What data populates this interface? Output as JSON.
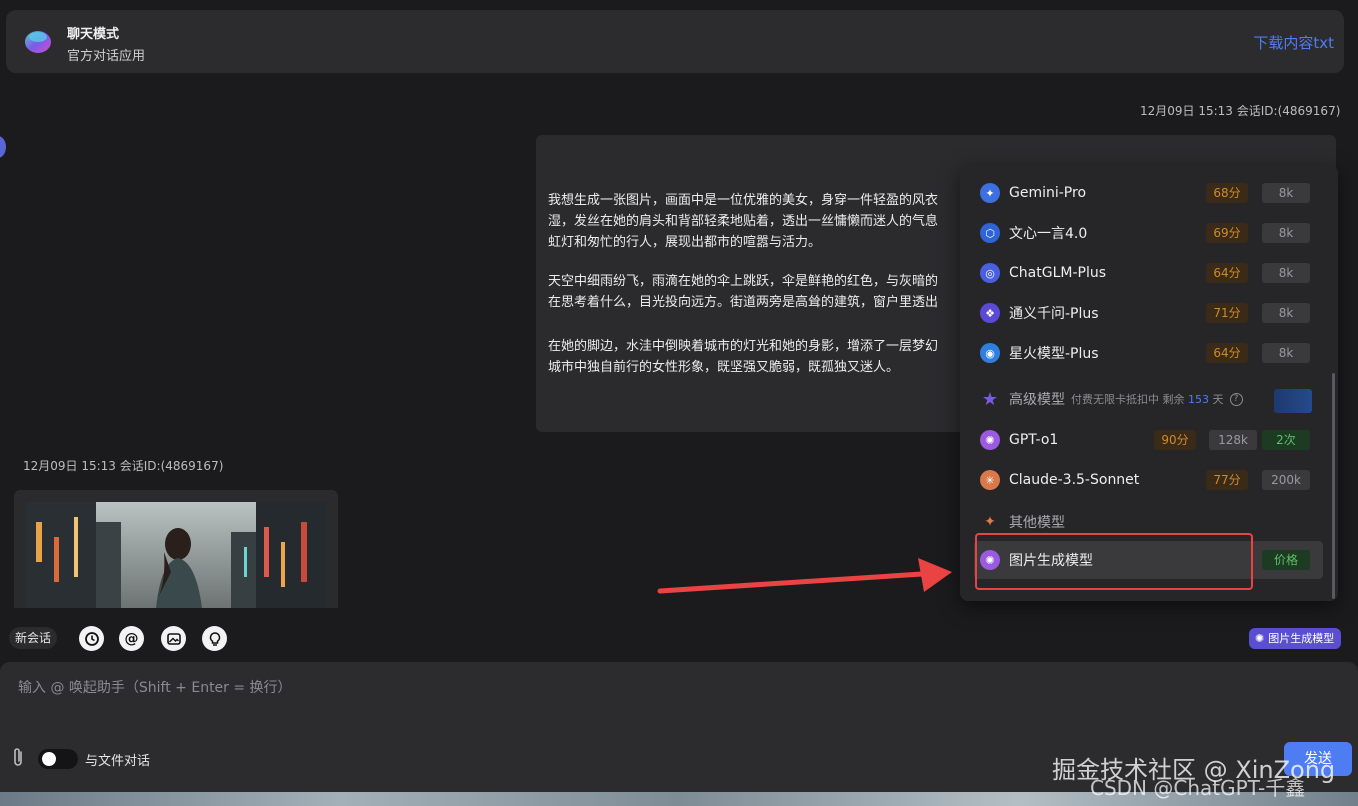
{
  "header": {
    "title": "聊天模式",
    "subtitle": "官方对话应用",
    "download": "下载内容txt"
  },
  "messages": {
    "user_meta": "12月09日 15:13 会话ID:(4869167)",
    "user_paragraphs": [
      "我想生成一张图片，画面中是一位优雅的美女，身穿一件轻盈的风衣\n湿，发丝在她的肩头和背部轻柔地贴着，透出一丝慵懒而迷人的气息\n虹灯和匆忙的行人，展现出都市的喧嚣与活力。",
      "天空中细雨纷飞，雨滴在她的伞上跳跃，伞是鲜艳的红色，与灰暗的\n在思考着什么，目光投向远方。街道两旁是高耸的建筑，窗户里透出",
      "在她的脚边，水洼中倒映着城市的灯光和她的身影，增添了一层梦幻\n城市中独自前行的女性形象，既坚强又脆弱，既孤独又迷人。"
    ],
    "assistant_meta": "12月09日 15:13 会话ID:(4869167)"
  },
  "toolbar": {
    "new_chat": "新会话",
    "selected_model": "图片生成模型"
  },
  "input": {
    "placeholder": "输入 @ 唤起助手（Shift + Enter = 换行）",
    "file_toggle_label": "与文件对话",
    "send": "发送"
  },
  "dropdown": {
    "models": [
      {
        "name": "Gemini-Pro",
        "price": "68分",
        "ctx": "8k",
        "color": "#3d6fe0",
        "glyph": "✦"
      },
      {
        "name": "文心一言4.0",
        "price": "69分",
        "ctx": "8k",
        "color": "#2f63d8",
        "glyph": "⬡"
      },
      {
        "name": "ChatGLM-Plus",
        "price": "64分",
        "ctx": "8k",
        "color": "#4a5ee0",
        "glyph": "◎"
      },
      {
        "name": "通义千问-Plus",
        "price": "71分",
        "ctx": "8k",
        "color": "#5b4ad6",
        "glyph": "❖"
      },
      {
        "name": "星火模型-Plus",
        "price": "64分",
        "ctx": "8k",
        "color": "#2f7fe0",
        "glyph": "◉"
      }
    ],
    "advanced_section": {
      "name": "高级模型",
      "note_prefix": "付费无限卡抵扣中 剩余",
      "days": "153",
      "note_suffix": "天",
      "help": "?"
    },
    "advanced_models": [
      {
        "name": "GPT-o1",
        "price": "90分",
        "ctx": "128k",
        "count": "2次",
        "color": "#9a5be0",
        "glyph": "✺"
      },
      {
        "name": "Claude-3.5-Sonnet",
        "price": "77分",
        "ctx": "200k",
        "color": "#d9784a",
        "glyph": "✳"
      }
    ],
    "other_section": {
      "name": "其他模型"
    },
    "other_models": [
      {
        "name": "图片生成模型",
        "tag": "价格",
        "color": "#9a5be0",
        "glyph": "✺"
      }
    ]
  },
  "watermark": {
    "line1": "掘金技术社区 @ XinZong",
    "line2": "CSDN @ChatGPT-千鑫"
  }
}
